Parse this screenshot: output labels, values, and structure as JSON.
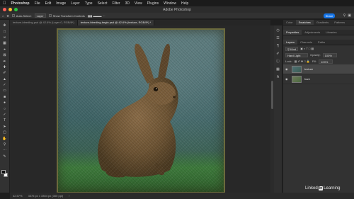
{
  "menubar": {
    "items": [
      "Photoshop",
      "File",
      "Edit",
      "Image",
      "Layer",
      "Type",
      "Select",
      "Filter",
      "3D",
      "View",
      "Plugins",
      "Window",
      "Help"
    ]
  },
  "window": {
    "title": "Adobe Photoshop"
  },
  "options": {
    "auto_select_label": "Auto-Select:",
    "auto_select_value": "Layer",
    "transform_label": "Show Transform Controls",
    "share_label": "Share"
  },
  "doc_tabs": [
    "texture-bleeding.psd @ 42.6% (Layer 0, RGB/8*)",
    "texture-bleeding-begin.psd @ 42.6% (texture, RGB/8*) *"
  ],
  "panels": {
    "top_tabs": [
      "Color",
      "Swatches",
      "Gradients",
      "Patterns"
    ],
    "mid_tabs": [
      "Properties",
      "Adjustments",
      "Libraries"
    ],
    "layer_tabs": [
      "Layers",
      "Channels",
      "Paths"
    ],
    "kind_label": "Kind",
    "blend_mode": "Hard Light",
    "opacity_label": "Opacity:",
    "opacity_value": "100%",
    "lock_label": "Lock:",
    "fill_label": "Fill:",
    "fill_value": "100%",
    "layers": [
      {
        "name": "texture",
        "selected": true
      },
      {
        "name": "hare",
        "selected": false
      }
    ]
  },
  "status": {
    "zoom": "42.57%",
    "doc_info": "3375 px x 3304 px (300 ppi)"
  },
  "watermark": {
    "prefix": "Linked",
    "badge": "in",
    "suffix": "Learning"
  },
  "colors": {
    "accent": "#1473e6",
    "traffic_red": "#ff5f57",
    "traffic_yellow": "#febc2e",
    "traffic_green": "#28c840"
  }
}
